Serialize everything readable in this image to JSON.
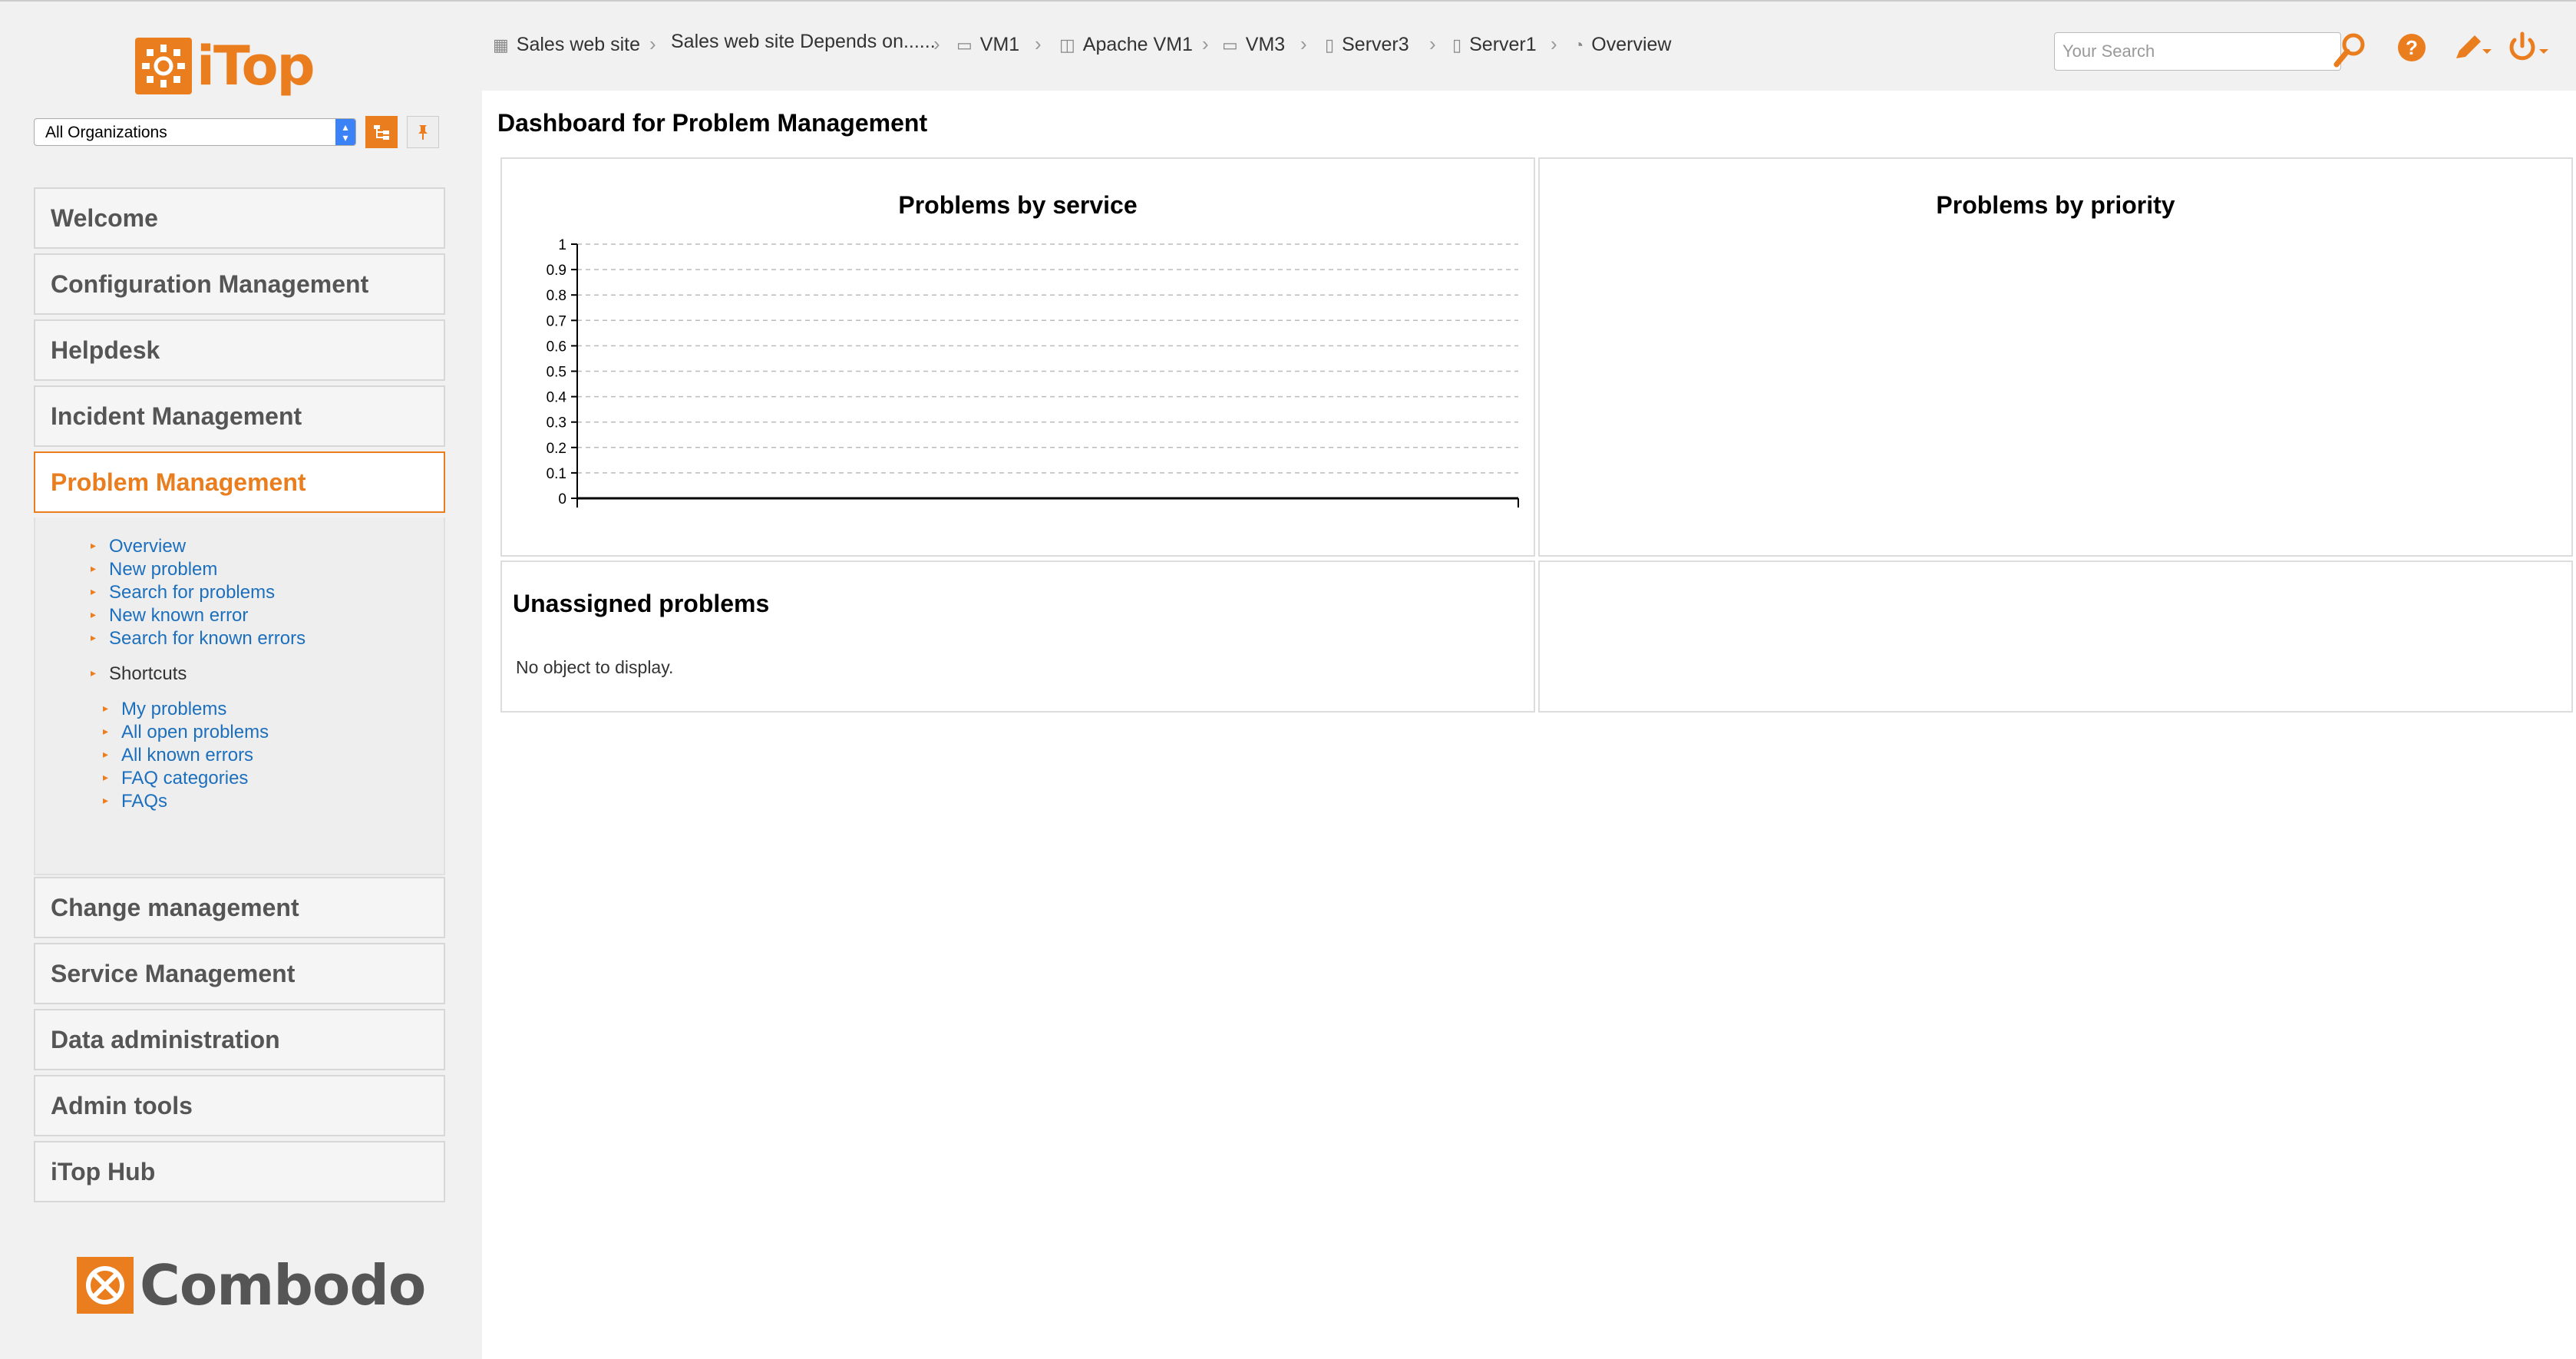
{
  "sidebar": {
    "logo_text": "iTop",
    "org_select": "All Organizations",
    "menus": [
      "Welcome",
      "Configuration Management",
      "Helpdesk",
      "Incident Management",
      "Problem Management",
      "Change management",
      "Service Management",
      "Data administration",
      "Admin tools",
      "iTop Hub"
    ],
    "active_menu": "Problem Management",
    "submenu": {
      "items": [
        "Overview",
        "New problem",
        "Search for problems",
        "New known error",
        "Search for known errors"
      ],
      "shortcuts_label": "Shortcuts",
      "shortcuts": [
        "My problems",
        "All open problems",
        "All known errors",
        "FAQ categories",
        "FAQs"
      ]
    },
    "footer_logo_text": "Combodo"
  },
  "breadcrumbs": [
    {
      "label": "Sales web site",
      "icon": "group-icon"
    },
    {
      "label": "Sales web site Depends on......",
      "icon": ""
    },
    {
      "label": "VM1",
      "icon": "vm-icon"
    },
    {
      "label": "Apache VM1",
      "icon": "webserver-icon"
    },
    {
      "label": "VM3",
      "icon": "vm-icon"
    },
    {
      "label": "Server3",
      "icon": "server-icon"
    },
    {
      "label": "Server1",
      "icon": "server-icon"
    },
    {
      "label": "Overview",
      "icon": "pie-icon"
    }
  ],
  "search": {
    "placeholder": "Your Search"
  },
  "page_title": "Dashboard for Problem Management",
  "panels": {
    "by_service_title": "Problems by service",
    "by_priority_title": "Problems by priority",
    "unassigned_title": "Unassigned problems",
    "unassigned_empty": "No object to display."
  },
  "colors": {
    "accent": "#ea7d1e",
    "link": "#1c6fbd"
  },
  "chart_data": {
    "type": "bar",
    "title": "Problems by service",
    "categories": [],
    "values": [],
    "ylim": [
      0,
      1
    ],
    "yticks": [
      "0",
      "0.1",
      "0.2",
      "0.3",
      "0.4",
      "0.5",
      "0.6",
      "0.7",
      "0.8",
      "0.9",
      "1"
    ],
    "grid": true
  }
}
